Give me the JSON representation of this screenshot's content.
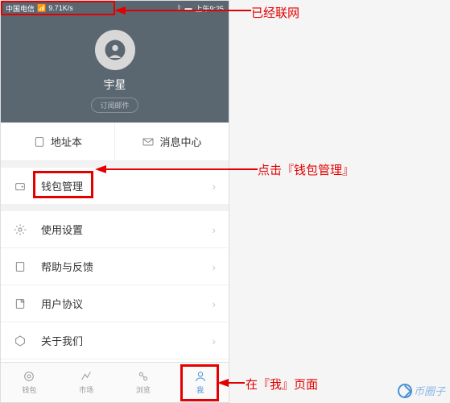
{
  "status": {
    "carrier": "中国电信",
    "speed": "9.71K/s",
    "time": "上午9:25"
  },
  "profile": {
    "username": "宇星",
    "sub_label": "订阅邮件"
  },
  "quick": {
    "addressbook": "地址本",
    "messages": "消息中心"
  },
  "menu": {
    "wallet": "钱包管理",
    "settings": "使用设置",
    "help": "帮助与反馈",
    "agreement": "用户协议",
    "about": "关于我们"
  },
  "tabs": {
    "wallet": "钱包",
    "market": "市场",
    "browse": "浏览",
    "me": "我"
  },
  "annotations": {
    "connected": "已经联网",
    "click_wallet": "点击『钱包管理』",
    "on_me_page": "在『我』页面"
  },
  "watermark": "币圈子"
}
